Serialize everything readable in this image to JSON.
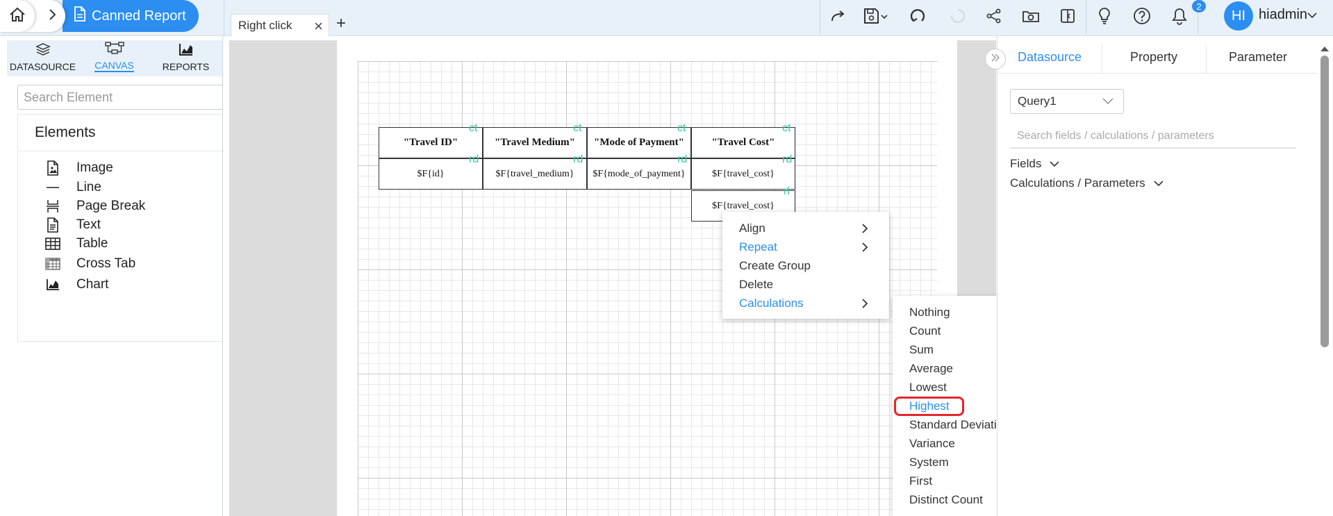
{
  "breadcrumb": {
    "home_icon": "home-icon",
    "report_title": "Canned Report"
  },
  "tabs": {
    "open_tab": "Right click",
    "add_tab": "+"
  },
  "toolbar": {
    "icons": [
      "redo-icon",
      "save-icon",
      "refresh-icon",
      "loading-icon",
      "share-icon",
      "preview-icon",
      "layout-icon",
      "bulb-icon",
      "help-icon",
      "bell-icon"
    ],
    "notification_count": "2",
    "avatar_initials": "HI",
    "username": "hiadmin"
  },
  "left_panel": {
    "tabs": [
      {
        "label": "DATASOURCE",
        "icon": "database-icon"
      },
      {
        "label": "CANVAS",
        "icon": "canvas-icon"
      },
      {
        "label": "REPORTS",
        "icon": "reports-icon"
      }
    ],
    "search_placeholder": "Search Element",
    "elements_title": "Elements",
    "elements": [
      {
        "label": "Image",
        "icon": "image-file-icon"
      },
      {
        "label": "Line",
        "icon": "line-icon"
      },
      {
        "label": "Page Break",
        "icon": "page-break-icon"
      },
      {
        "label": "Text",
        "icon": "text-file-icon"
      },
      {
        "label": "Table",
        "icon": "table-icon"
      },
      {
        "label": "Cross Tab",
        "icon": "cross-tab-icon"
      },
      {
        "label": "Chart",
        "icon": "chart-icon"
      }
    ]
  },
  "canvas": {
    "headers": [
      "\"Travel ID\"",
      "\"Travel Medium\"",
      "\"Mode of Payment\"",
      "\"Travel Cost\""
    ],
    "fields": [
      "$F{id}",
      "$F{travel_medium}",
      "$F{mode_of_payment}",
      "$F{travel_cost}"
    ],
    "total_field": "$F{travel_cost}",
    "header_tag": "ct",
    "field_tag": "rd",
    "total_tag": "rl"
  },
  "context_menu": {
    "items": [
      "Align",
      "Repeat",
      "Create Group",
      "Delete",
      "Calculations"
    ]
  },
  "calculations_menu": {
    "items": [
      "Nothing",
      "Count",
      "Sum",
      "Average",
      "Lowest",
      "Highest",
      "Standard Deviation",
      "Variance",
      "System",
      "First",
      "Distinct Count"
    ],
    "highlighted": "Highest"
  },
  "right_panel": {
    "tabs": [
      "Datasource",
      "Property",
      "Parameter"
    ],
    "active_tab": "Datasource",
    "query_select": "Query1",
    "search_placeholder": "Search fields / calculations / parameters",
    "sections": [
      "Fields",
      "Calculations / Parameters"
    ]
  },
  "colors": {
    "accent": "#2b8ef0",
    "highlight": "#e3262b",
    "tag": "#3cc7a3"
  }
}
